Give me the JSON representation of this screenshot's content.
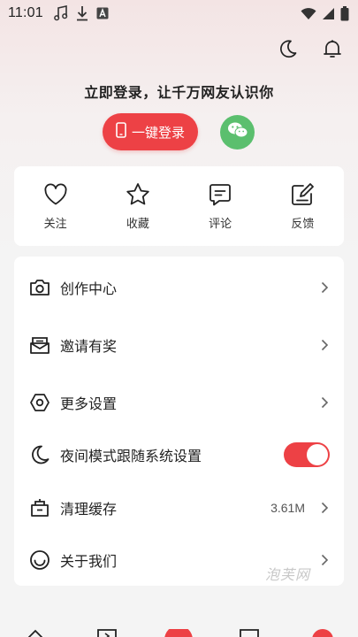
{
  "status_bar": {
    "time": "11:01",
    "left_icons": [
      "music-note-icon",
      "download-icon",
      "a-badge-icon"
    ],
    "right_icons": [
      "wifi-icon",
      "cell-signal-icon",
      "battery-icon"
    ]
  },
  "header": {
    "icons": [
      "moon-icon",
      "bell-icon"
    ],
    "login_prompt": "立即登录，让千万网友认识你",
    "login_button_label": "一键登录",
    "wechat_icon": "wechat-icon"
  },
  "quick_actions": [
    {
      "label": "关注",
      "icon": "heart-icon"
    },
    {
      "label": "收藏",
      "icon": "star-icon"
    },
    {
      "label": "评论",
      "icon": "comment-icon"
    },
    {
      "label": "反馈",
      "icon": "feedback-icon"
    }
  ],
  "menu": [
    {
      "label": "创作中心",
      "icon": "camera-icon",
      "value": ""
    },
    {
      "label": "邀请有奖",
      "icon": "envelope-icon",
      "value": ""
    },
    {
      "label": "更多设置",
      "icon": "hexagon-settings-icon",
      "value": ""
    },
    {
      "label": "夜间模式跟随系统设置",
      "icon": "moon-icon",
      "toggle_on": true
    },
    {
      "label": "清理缓存",
      "icon": "cache-basket-icon",
      "value": "3.61M"
    },
    {
      "label": "关于我们",
      "icon": "smile-icon",
      "value": ""
    }
  ],
  "watermark": "泡芙网",
  "colors": {
    "accent": "#ed4145",
    "wechat": "#5bbf6e",
    "background": "#f4f4f4"
  }
}
